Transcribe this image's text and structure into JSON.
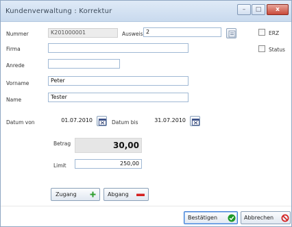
{
  "window": {
    "title": "Kundenverwaltung : Korrektur",
    "controls": {
      "minimize": "–",
      "maximize": "□",
      "close": "x"
    }
  },
  "form": {
    "nummer": {
      "label": "Nummer",
      "value": "K201000001"
    },
    "ausweis": {
      "label": "Ausweis",
      "value": "2"
    },
    "firma": {
      "label": "Firma",
      "value": ""
    },
    "anrede": {
      "label": "Anrede",
      "value": ""
    },
    "vorname": {
      "label": "Vorname",
      "value": "Peter"
    },
    "name": {
      "label": "Name",
      "value": "Tester"
    },
    "datum_von": {
      "label": "Datum von",
      "value": "01.07.2010"
    },
    "datum_bis": {
      "label": "Datum bis",
      "value": "31.07.2010"
    },
    "erz": {
      "label": "ERZ",
      "checked": false
    },
    "status": {
      "label": "Status",
      "checked": false
    }
  },
  "amounts": {
    "betrag": {
      "label": "Betrag",
      "value": "30,00"
    },
    "limit": {
      "label": "Limit",
      "value": "250,00"
    }
  },
  "actions": {
    "zugang": "Zugang",
    "abgang": "Abgang",
    "bestatigen": "Bestätigen",
    "abbrechen": "Abbrechen"
  },
  "icons": {
    "lookup": "magnifier-icon",
    "calendar": "calendar-icon",
    "plus": "plus-icon",
    "minus": "minus-icon",
    "confirm": "check-icon",
    "cancel": "no-entry-icon"
  },
  "colors": {
    "plus": "#2e9e2e",
    "minus": "#d42020",
    "confirm": "#1f9a2a",
    "cancel": "#d42020",
    "close_button": "#c94a3a"
  }
}
